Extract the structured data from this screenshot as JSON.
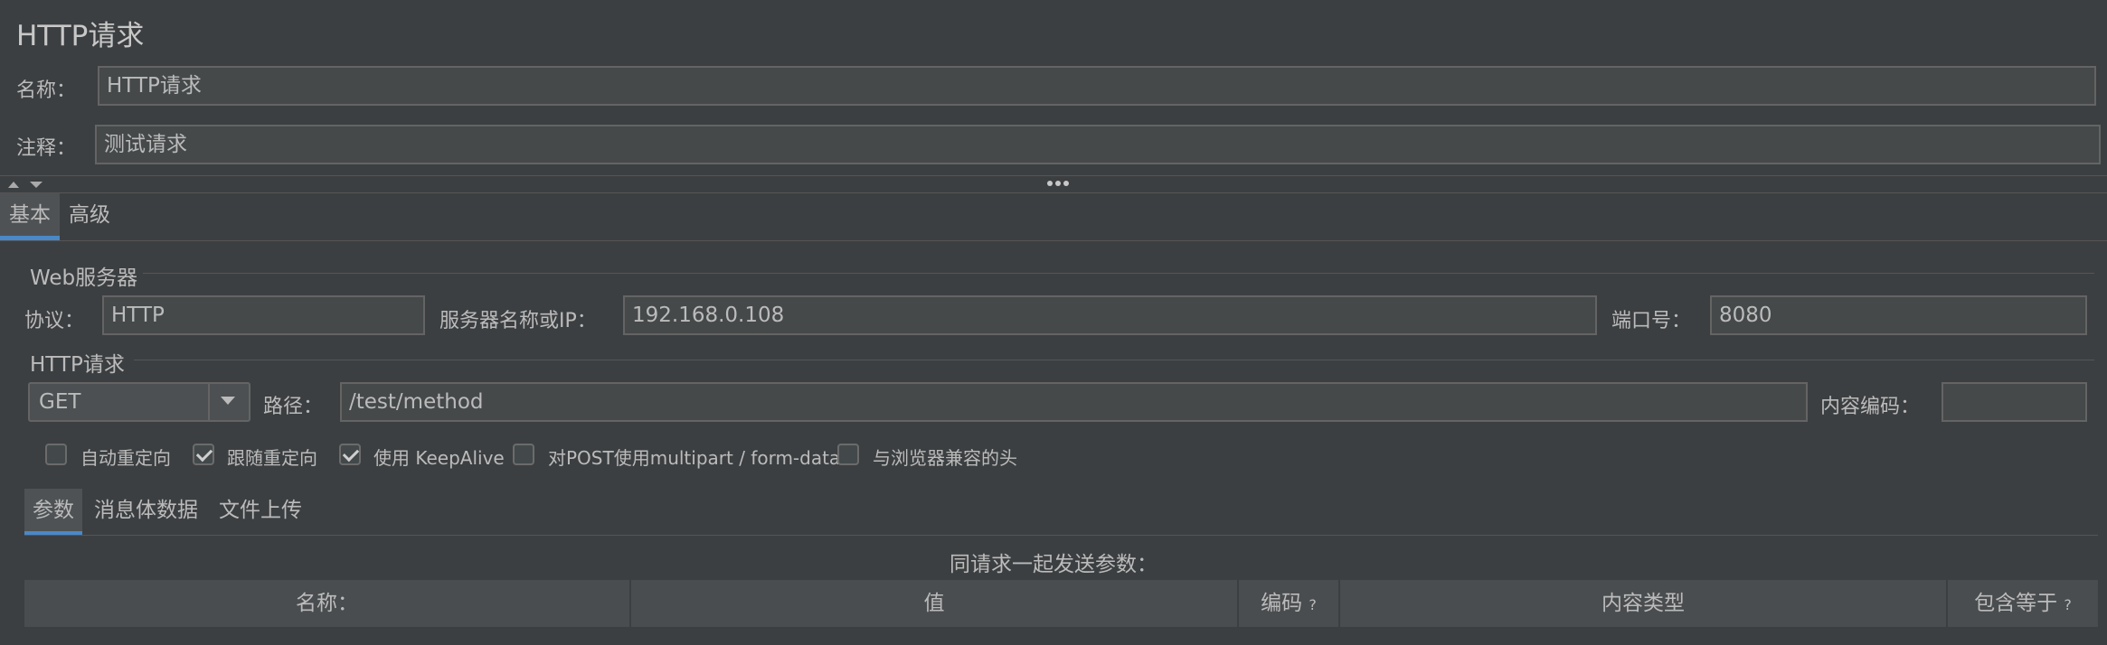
{
  "page": {
    "title": "HTTP请求"
  },
  "name_field": {
    "label": "名称：",
    "value": "HTTP请求"
  },
  "comment_field": {
    "label": "注释：",
    "value": "测试请求"
  },
  "tabs": [
    {
      "label": "基本",
      "active": true
    },
    {
      "label": "高级",
      "active": false
    }
  ],
  "web_server": {
    "section_title": "Web服务器",
    "protocol": {
      "label": "协议：",
      "value": "HTTP"
    },
    "server": {
      "label": "服务器名称或IP：",
      "value": "192.168.0.108"
    },
    "port": {
      "label": "端口号：",
      "value": "8080"
    }
  },
  "http_request": {
    "section_title": "HTTP请求",
    "method": {
      "value": "GET"
    },
    "path": {
      "label": "路径：",
      "value": "/test/method"
    },
    "encoding": {
      "label": "内容编码：",
      "value": ""
    }
  },
  "options": [
    {
      "label": "自动重定向",
      "checked": false
    },
    {
      "label": "跟随重定向",
      "checked": true
    },
    {
      "label": "使用 KeepAlive",
      "checked": true
    },
    {
      "label": "对POST使用multipart / form-data",
      "checked": false
    },
    {
      "label": "与浏览器兼容的头",
      "checked": false
    }
  ],
  "body_tabs": [
    {
      "label": "参数",
      "active": true
    },
    {
      "label": "消息体数据",
      "active": false
    },
    {
      "label": "文件上传",
      "active": false
    }
  ],
  "params": {
    "caption": "同请求一起发送参数：",
    "columns": [
      {
        "label": "名称：",
        "help": ""
      },
      {
        "label": "值",
        "help": ""
      },
      {
        "label": "编码",
        "help": "?"
      },
      {
        "label": "内容类型",
        "help": ""
      },
      {
        "label": "包含等于",
        "help": "?"
      }
    ]
  },
  "colors": {
    "background": "#3c3f41",
    "field_bg": "#45494a",
    "accent": "#4a88c7",
    "text": "#bbbbbb"
  }
}
